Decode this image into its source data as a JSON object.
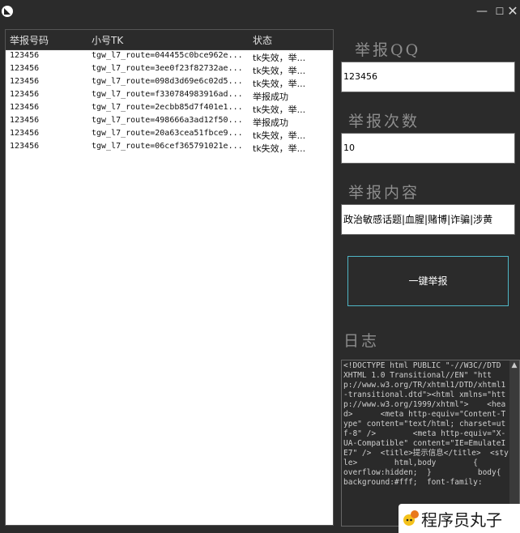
{
  "window": {
    "minimize_glyph": "—",
    "maximize_glyph": "☐",
    "close_glyph": "✕"
  },
  "table": {
    "columns": [
      "举报号码",
      "小号TK",
      "状态"
    ],
    "rows": [
      [
        "123456",
        "tgw_l7_route=044455c0bce962e...",
        "tk失效，举..."
      ],
      [
        "123456",
        "tgw_l7_route=3ee0f23f82732ae...",
        "tk失效，举..."
      ],
      [
        "123456",
        "tgw_l7_route=098d3d69e6c02d5...",
        "tk失效，举..."
      ],
      [
        "123456",
        "tgw_l7_route=f330784983916ad...",
        "举报成功"
      ],
      [
        "123456",
        "tgw_l7_route=2ecbb85d7f401e1...",
        "tk失效，举..."
      ],
      [
        "123456",
        "tgw_l7_route=498666a3ad12f50...",
        "举报成功"
      ],
      [
        "123456",
        "tgw_l7_route=20a63cea51fbce9...",
        "tk失效，举..."
      ],
      [
        "123456",
        "tgw_l7_route=06cef365791021e...",
        "tk失效，举..."
      ]
    ]
  },
  "form": {
    "qq_label": "举报QQ",
    "qq_value": "123456",
    "count_label": "举报次数",
    "count_value": "10",
    "content_label": "举报内容",
    "content_value": "政治敏感话题|血腥|赌博|诈骗|涉黄",
    "submit_label": "一键举报"
  },
  "log": {
    "label": "日志",
    "text": "<!DOCTYPE html PUBLIC \"-//W3C//DTD XHTML 1.0 Transitional//EN\" \"http://www.w3.org/TR/xhtml1/DTD/xhtml1-transitional.dtd\"><html xmlns=\"http://www.w3.org/1999/xhtml\">    <head>      <meta http-equiv=\"Content-Type\" content=\"text/html; charset=utf-8\" />        <meta http-equiv=\"X-UA-Compatible\" content=\"IE=EmulateIE7\" />  <title>提示信息</title>  <style>        html,body        {        overflow:hidden;  }          body{  background:#fff;  font-family:"
  },
  "watermark": {
    "text": "程序员丸子"
  },
  "colors": {
    "background": "#2b2b2b",
    "button_border": "#4fb6c6",
    "label": "#8d8d8d"
  }
}
